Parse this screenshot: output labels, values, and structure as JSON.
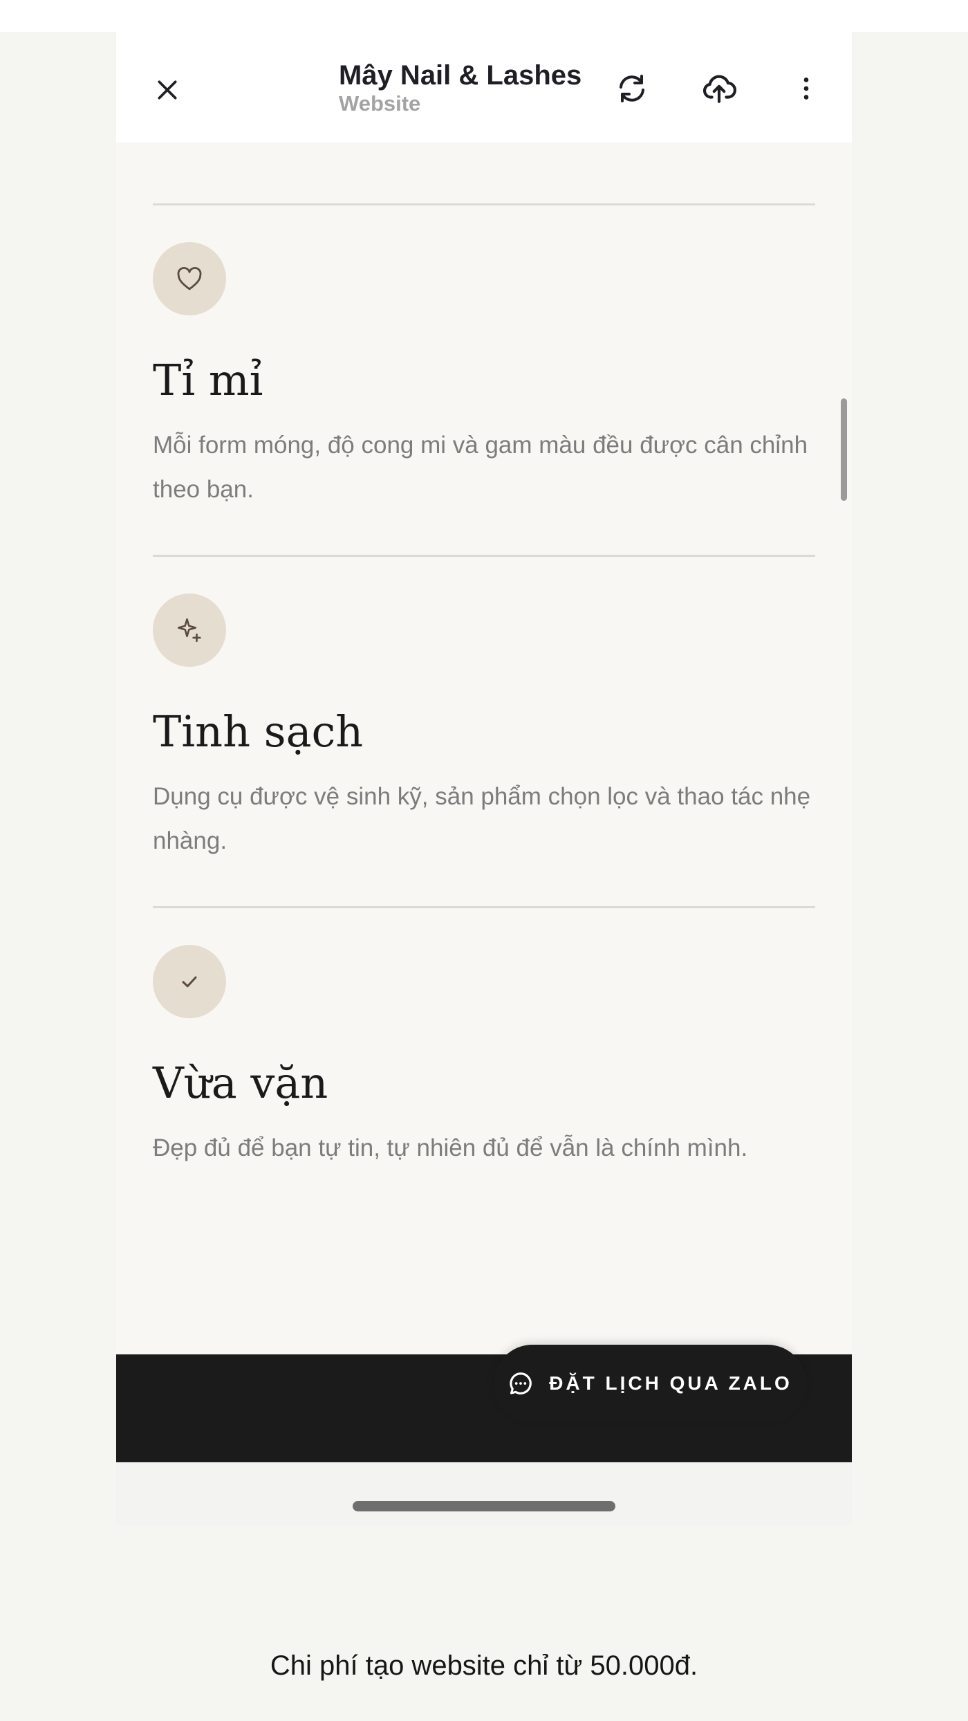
{
  "header": {
    "title": "Mây Nail & Lashes",
    "subtitle": "Website",
    "icons": [
      "close-icon",
      "refresh-icon",
      "cloud-upload-icon",
      "more-vertical-icon"
    ]
  },
  "features": [
    {
      "icon": "heart-icon",
      "title": "Tỉ mỉ",
      "description": "Mỗi form móng, độ cong mi và gam màu đều được cân chỉnh theo bạn."
    },
    {
      "icon": "sparkle-icon",
      "title": "Tinh sạch",
      "description": "Dụng cụ được vệ sinh kỹ, sản phẩm chọn lọc và thao tác nhẹ nhàng."
    },
    {
      "icon": "check-icon",
      "title": "Vừa vặn",
      "description": "Đẹp đủ để bạn tự tin, tự nhiên đủ để vẫn là chính mình."
    }
  ],
  "cta": {
    "label": "ĐẶT LỊCH QUA ZALO",
    "icon": "chat-bubble-icon"
  },
  "caption": "Chi phí tạo website chỉ từ 50.000đ.",
  "colors": {
    "page_background": "#f9f7f4",
    "icon_circle": "#e6ddd1",
    "cta_background": "#1b1b1b",
    "title_text": "#1a1a1a",
    "body_text": "#7c7c7c"
  }
}
